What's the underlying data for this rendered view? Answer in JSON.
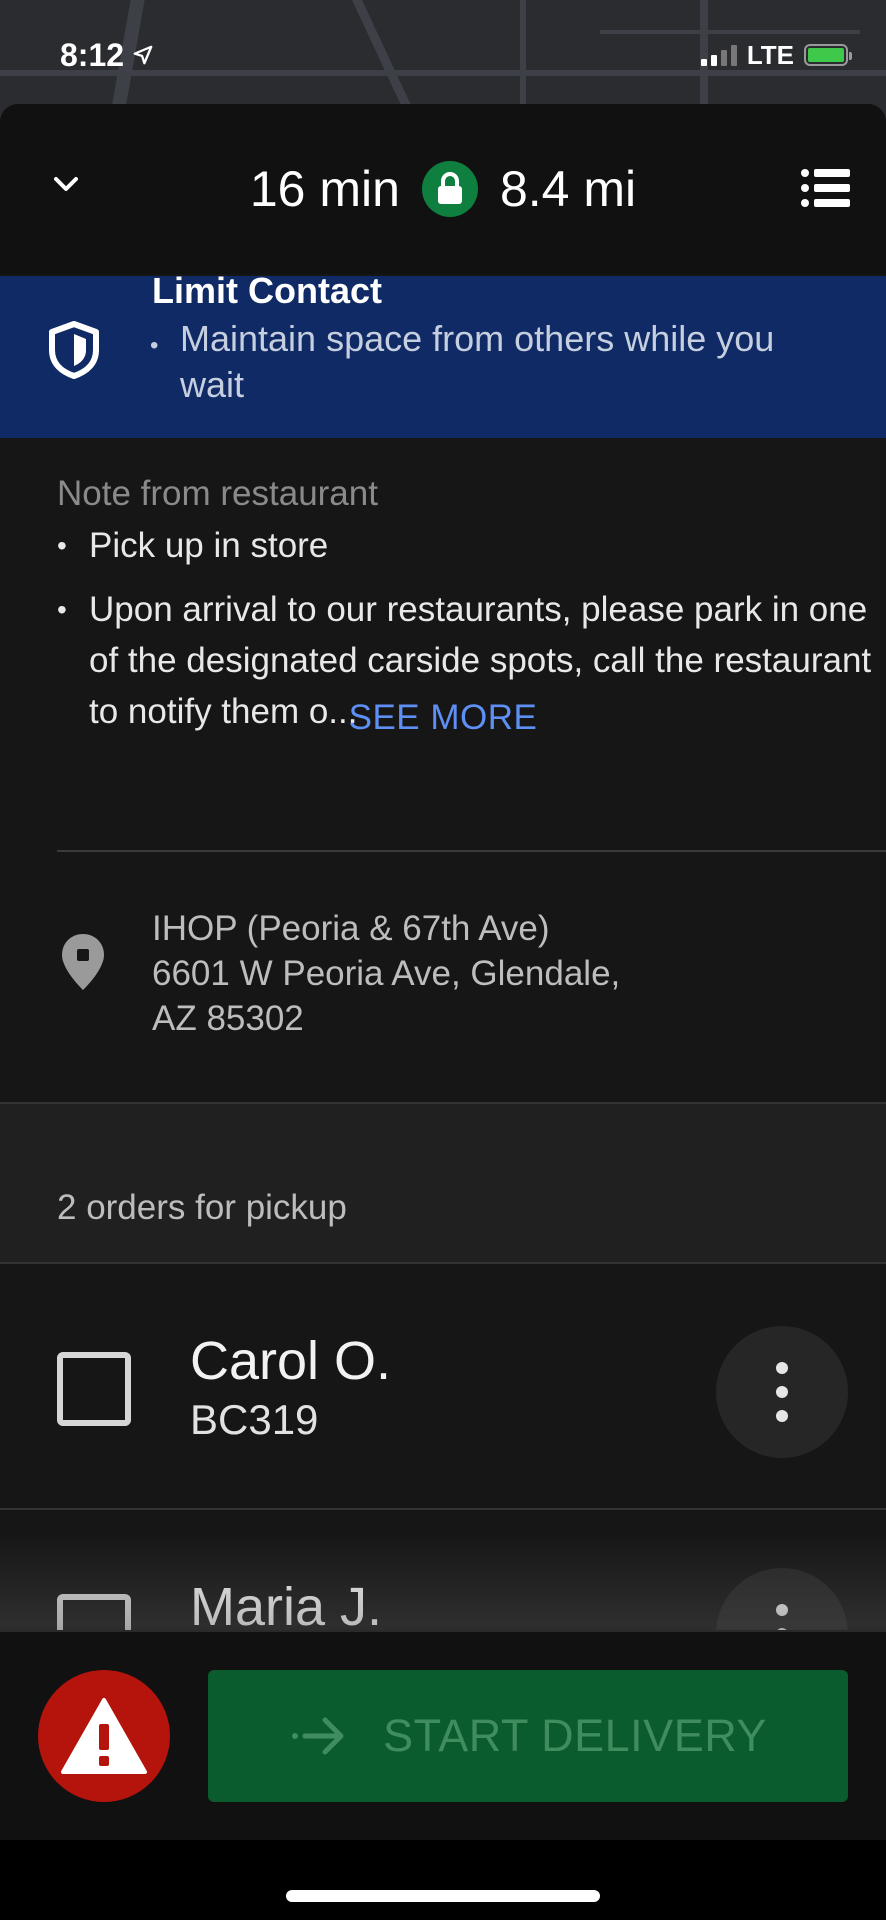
{
  "status": {
    "time": "8:12",
    "network": "LTE"
  },
  "trip": {
    "eta": "16 min",
    "distance": "8.4 mi"
  },
  "limit_contact": {
    "title": "Limit Contact",
    "bullet": "•",
    "text": "Maintain space from others while you wait"
  },
  "note": {
    "label": "Note from restaurant",
    "items": [
      "Pick up in store",
      "Upon arrival to our restaurants, please park in one of the designated carside spots, call the restaurant to notify them o..."
    ],
    "bullet": "•",
    "see_more": "SEE MORE"
  },
  "restaurant": {
    "name": "IHOP (Peoria & 67th Ave)",
    "address_line1": "6601 W Peoria Ave, Glendale,",
    "address_line2": "AZ 85302"
  },
  "orders": {
    "header": "2 orders for pickup",
    "items": [
      {
        "name": "Carol O.",
        "code": "BC319"
      },
      {
        "name": "Maria J.",
        "code": ""
      }
    ]
  },
  "actions": {
    "start_delivery": "START DELIVERY"
  },
  "colors": {
    "accent_link": "#5e8ff4",
    "banner_blue": "#0f2a64",
    "lock_green": "#0e7f3e",
    "start_green": "#0a5b2d",
    "alert_red": "#b5140d"
  }
}
